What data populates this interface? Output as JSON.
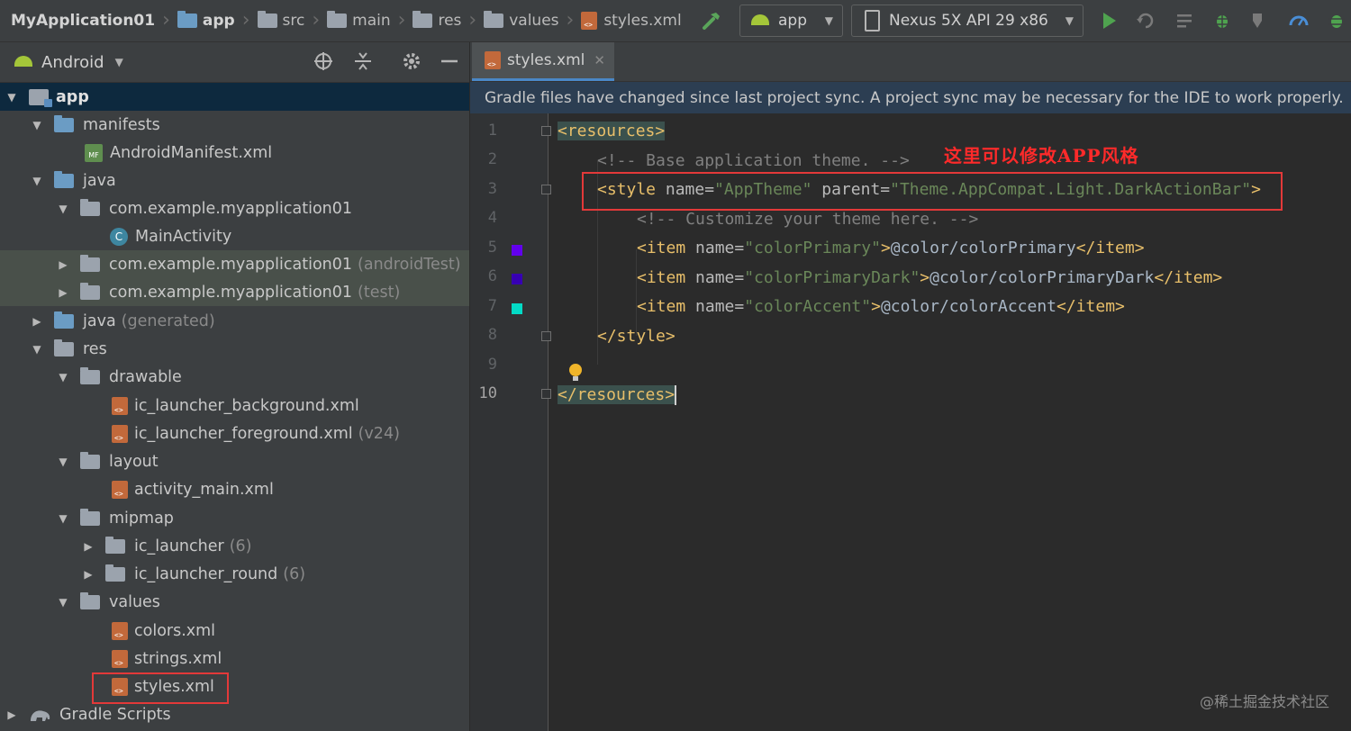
{
  "breadcrumbs": [
    "MyApplication01",
    "app",
    "src",
    "main",
    "res",
    "values",
    "styles.xml"
  ],
  "toolbar": {
    "config_dropdown": "app",
    "device_dropdown": "Nexus 5X API 29 x86"
  },
  "project_panel": {
    "view_selector": "Android",
    "tree": [
      {
        "label": "app",
        "suffix": "",
        "expanded": "▼"
      },
      {
        "label": "manifests",
        "suffix": "",
        "expanded": "▼"
      },
      {
        "label": "AndroidManifest.xml",
        "suffix": "",
        "icon_text": "MF"
      },
      {
        "label": "java",
        "suffix": "",
        "expanded": "▼"
      },
      {
        "label": "com.example.myapplication01",
        "suffix": "",
        "expanded": "▼"
      },
      {
        "label": "MainActivity",
        "suffix": "",
        "icon_text": "C"
      },
      {
        "label": "com.example.myapplication01",
        "suffix": "(androidTest)",
        "expanded": "▶"
      },
      {
        "label": "com.example.myapplication01",
        "suffix": "(test)",
        "expanded": "▶"
      },
      {
        "label": "java",
        "suffix": "(generated)",
        "expanded": "▶"
      },
      {
        "label": "res",
        "suffix": "",
        "expanded": "▼"
      },
      {
        "label": "drawable",
        "suffix": "",
        "expanded": "▼"
      },
      {
        "label": "ic_launcher_background.xml",
        "suffix": ""
      },
      {
        "label": "ic_launcher_foreground.xml",
        "suffix": "(v24)"
      },
      {
        "label": "layout",
        "suffix": "",
        "expanded": "▼"
      },
      {
        "label": "activity_main.xml",
        "suffix": ""
      },
      {
        "label": "mipmap",
        "suffix": "",
        "expanded": "▼"
      },
      {
        "label": "ic_launcher",
        "suffix": "(6)",
        "expanded": "▶"
      },
      {
        "label": "ic_launcher_round",
        "suffix": "(6)",
        "expanded": "▶"
      },
      {
        "label": "values",
        "suffix": "",
        "expanded": "▼"
      },
      {
        "label": "colors.xml",
        "suffix": ""
      },
      {
        "label": "strings.xml",
        "suffix": ""
      },
      {
        "label": "styles.xml",
        "suffix": ""
      },
      {
        "label": "Gradle Scripts",
        "suffix": "",
        "expanded": "▶"
      }
    ]
  },
  "editor": {
    "tab_label": "styles.xml",
    "banner": "Gradle files have changed since last project sync. A project sync may be necessary for the IDE to work properly.",
    "line_numbers": [
      "1",
      "2",
      "3",
      "4",
      "5",
      "6",
      "7",
      "8",
      "9",
      "10"
    ],
    "code": {
      "l1_tag": "<resources>",
      "l2_comment": "<!-- Base application theme. -->",
      "l3_open": "<style ",
      "l3_attr1": "name=",
      "l3_val1": "\"AppTheme\"",
      "l3_attr2": " parent=",
      "l3_val2": "\"Theme.AppCompat.Light.DarkActionBar\"",
      "l3_close": ">",
      "l4_comment": "<!-- Customize your theme here. -->",
      "l5_open": "<item ",
      "l5_attr": "name=",
      "l5_val": "\"colorPrimary\"",
      "l5_close": ">",
      "l5_text": "@color/colorPrimary",
      "l5_end": "</item>",
      "l6_open": "<item ",
      "l6_attr": "name=",
      "l6_val": "\"colorPrimaryDark\"",
      "l6_close": ">",
      "l6_text": "@color/colorPrimaryDark",
      "l6_end": "</item>",
      "l7_open": "<item ",
      "l7_attr": "name=",
      "l7_val": "\"colorAccent\"",
      "l7_close": ">",
      "l7_text": "@color/colorAccent",
      "l7_end": "</item>",
      "l8_tag": "</style>",
      "l10_tag": "</resources>"
    },
    "swatch_colors": {
      "colorPrimary": "#6200ee",
      "colorPrimaryDark": "#3700b3",
      "colorAccent": "#03dac5"
    },
    "annotation": "这里可以修改APP风格"
  },
  "watermark": "@稀土掘金技术社区"
}
